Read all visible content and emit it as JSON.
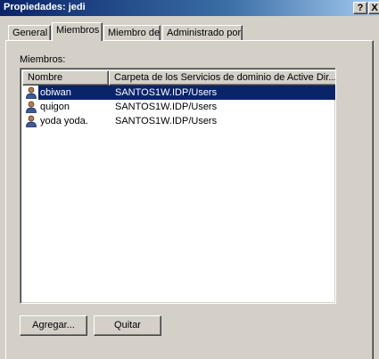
{
  "window": {
    "title": "Propiedades: jedi",
    "help_label": "?",
    "close_label": "X"
  },
  "tabs": [
    {
      "label": "General",
      "active": false
    },
    {
      "label": "Miembros",
      "active": true
    },
    {
      "label": "Miembro de",
      "active": false
    },
    {
      "label": "Administrado por",
      "active": false
    }
  ],
  "members": {
    "label": "Miembros:",
    "columns": [
      "Nombre",
      "Carpeta de los Servicios de dominio de Active Dir..."
    ],
    "rows": [
      {
        "name": "obiwan",
        "folder": "SANTOS1W.IDP/Users",
        "icon": "user-icon",
        "selected": true
      },
      {
        "name": "quigon",
        "folder": "SANTOS1W.IDP/Users",
        "icon": "user-icon",
        "selected": false
      },
      {
        "name": "yoda yoda.",
        "folder": "SANTOS1W.IDP/Users",
        "icon": "user-icon",
        "selected": false
      }
    ]
  },
  "buttons": {
    "add_label": "Agregar...",
    "remove_label": "Quitar"
  },
  "colors": {
    "selection": "#0a246a",
    "face": "#d4d0c8"
  }
}
